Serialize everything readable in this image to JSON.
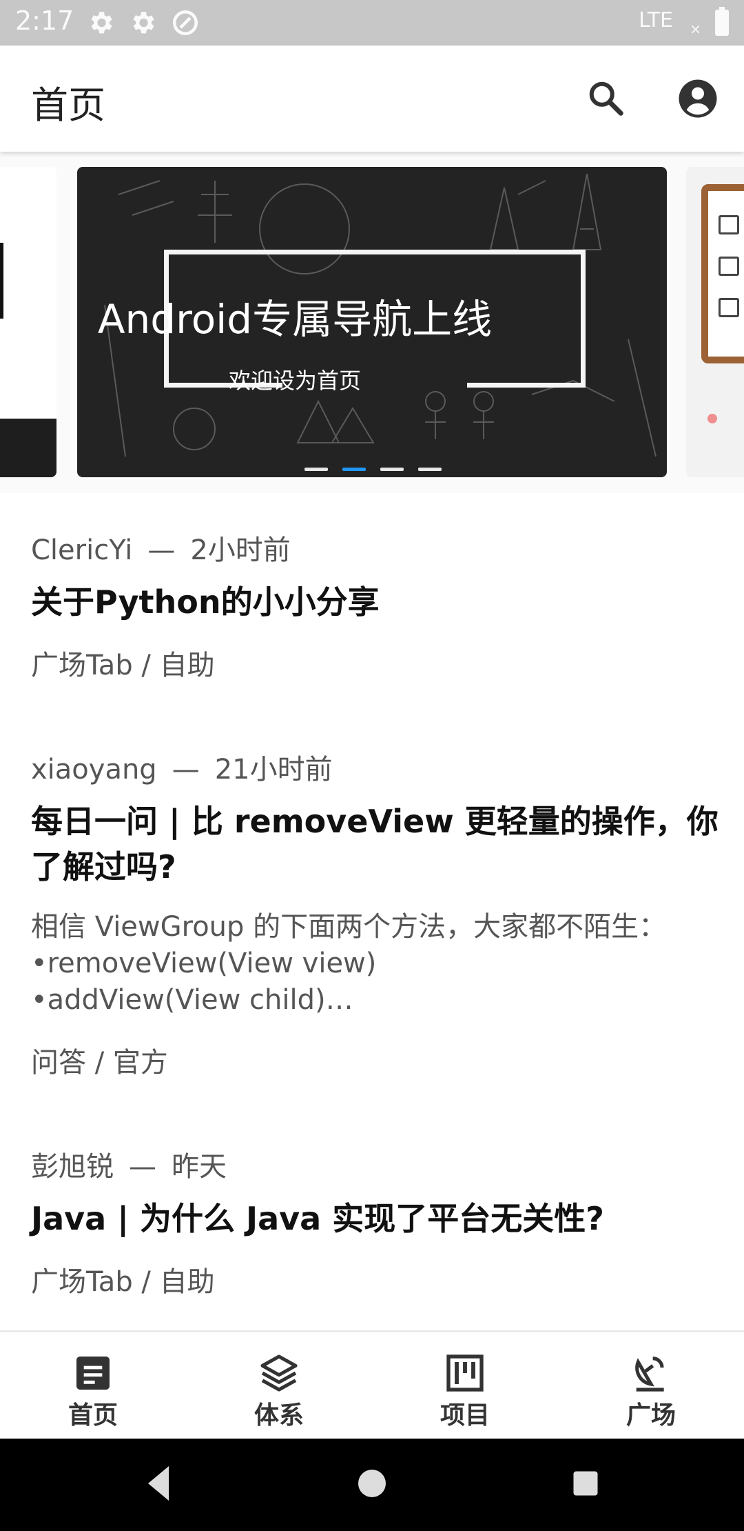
{
  "status_bar": {
    "time": "2:17",
    "network": "LTE"
  },
  "toolbar": {
    "title": "首页",
    "icons": [
      "search-icon",
      "account-circle-icon"
    ]
  },
  "banner": {
    "title": "Android专属导航上线",
    "subtitle": "欢迎设为首页",
    "page_count": 4,
    "active_index": 1,
    "indicator_color": "#2196f3"
  },
  "articles": [
    {
      "author": "ClericYi",
      "time": "2小时前",
      "title": "关于Python的小小分享",
      "desc": "",
      "category": "广场Tab / 自助"
    },
    {
      "author": "xiaoyang",
      "time": "21小时前",
      "title": "每日一问 | 比 removeView 更轻量的操作，你了解过吗?",
      "desc": "相信 ViewGroup 的下面两个方法，大家都不陌生：\n•removeView(View view)\n•addView(View child)…",
      "category": "问答 / 官方"
    },
    {
      "author": "彭旭锐",
      "time": "昨天",
      "title": "Java | 为什么 Java 实现了平台无关性?",
      "desc": "",
      "category": "广场Tab / 自助"
    }
  ],
  "bottom_nav": [
    {
      "label": "首页",
      "icon": "article-icon"
    },
    {
      "label": "体系",
      "icon": "layers-icon"
    },
    {
      "label": "项目",
      "icon": "kanban-icon"
    },
    {
      "label": "广场",
      "icon": "satellite-dish-icon"
    }
  ],
  "system_nav": [
    "back-icon",
    "home-icon",
    "recents-icon"
  ]
}
